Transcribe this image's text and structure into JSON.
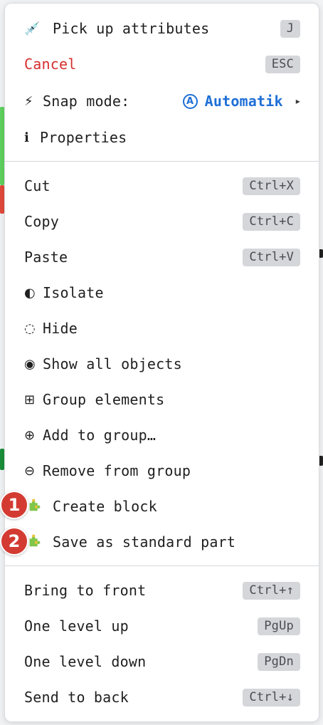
{
  "menu": {
    "tools": [
      {
        "icon": "syringe-icon",
        "glyph": "💉",
        "label": "Pick up attributes",
        "shortcut": "J"
      },
      {
        "icon": "",
        "glyph": "",
        "label": "Cancel",
        "shortcut": "ESC"
      },
      {
        "icon": "lightning-icon",
        "glyph": "⚡",
        "label": "Snap mode:",
        "value": "Automatik",
        "value_glyph": "A"
      },
      {
        "icon": "info-icon",
        "glyph": "ℹ",
        "label": "Properties"
      }
    ],
    "edit": [
      {
        "label": "Cut",
        "shortcut": "Ctrl+X"
      },
      {
        "label": "Copy",
        "shortcut": "Ctrl+C"
      },
      {
        "label": "Paste",
        "shortcut": "Ctrl+V"
      },
      {
        "icon": "half-circle-icon",
        "glyph": "◐",
        "label": "Isolate"
      },
      {
        "icon": "dotted-circle-icon",
        "glyph": "◌",
        "label": "Hide"
      },
      {
        "icon": "filled-circle-icon",
        "glyph": "◉",
        "label": "Show all objects"
      },
      {
        "icon": "squared-plus-icon",
        "glyph": "⊞",
        "label": "Group elements"
      },
      {
        "icon": "circled-plus-icon",
        "glyph": "⊕",
        "label": "Add to group…"
      },
      {
        "icon": "circled-minus-icon",
        "glyph": "⊖",
        "label": "Remove from group"
      },
      {
        "icon": "puzzle-icon",
        "label": "Create block",
        "badge": "1"
      },
      {
        "icon": "puzzle-icon",
        "label": "Save as standard part",
        "badge": "2"
      }
    ],
    "arrange": [
      {
        "label": "Bring to front",
        "shortcut": "Ctrl+↑"
      },
      {
        "label": "One level up",
        "shortcut": "PgUp"
      },
      {
        "label": "One level down",
        "shortcut": "PgDn"
      },
      {
        "label": "Send to back",
        "shortcut": "Ctrl+↓"
      }
    ]
  },
  "colors": {
    "cancel": "#d62d2d",
    "accent": "#1f6fd6",
    "badge": "#d33b32",
    "kbd_bg": "#d4d6da"
  }
}
